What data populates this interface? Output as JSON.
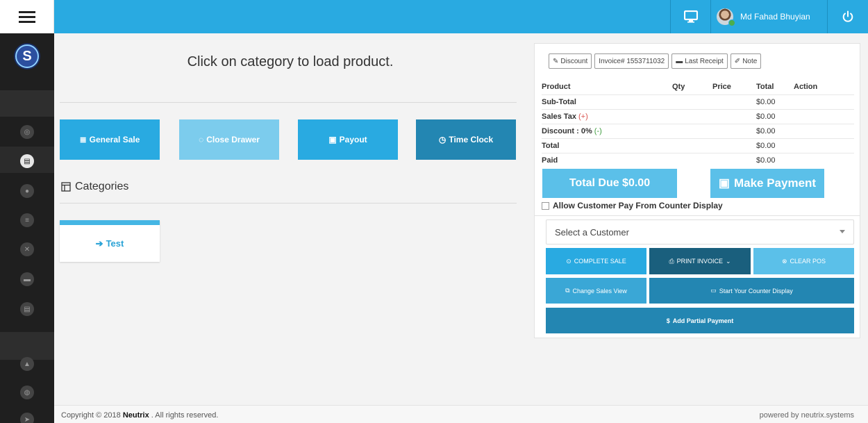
{
  "colors": {
    "topbar": "#29aae1",
    "sidebar": "#1f1f1f",
    "general_sale": "#29aae1",
    "close_drawer": "#7ccced",
    "payout": "#29aae1",
    "time_clock": "#2386b2",
    "total_due": "#5bc0e9",
    "complete_sale": "#29aae1",
    "print_invoice": "#1a5f7d",
    "clear_pos": "#5bc0e9",
    "change_sales_view": "#3aa7d6",
    "counter_display": "#2386b2",
    "partial_payment": "#2386b2"
  },
  "topbar": {
    "user_name": "Md Fahad Bhuyian",
    "monitor_icon": "monitor-icon",
    "power_icon": "power-icon"
  },
  "sidebar": {
    "logo_letter": "S",
    "icons": [
      "dashboard-icon",
      "basket-icon",
      "user-icon",
      "database-icon",
      "close-circle-icon",
      "cart-icon",
      "basket-icon",
      "chart-icon",
      "globe-icon",
      "arrow-icon"
    ]
  },
  "main": {
    "title": "Click on category to load product.",
    "buttons": {
      "general_sale": "General Sale",
      "close_drawer": "Close Drawer",
      "payout": "Payout",
      "time_clock": "Time Clock"
    },
    "categories_title": "Categories",
    "category_items": [
      {
        "label": "Test"
      }
    ]
  },
  "panel": {
    "toolbar": {
      "discount": "Discount",
      "invoice": "Invoice# 1553711032",
      "last_receipt": "Last Receipt",
      "note": "Note"
    },
    "columns": {
      "product": "Product",
      "qty": "Qty",
      "price": "Price",
      "total": "Total",
      "action": "Action"
    },
    "rows": {
      "subtotal": {
        "label": "Sub-Total",
        "value": "$0.00"
      },
      "sales_tax": {
        "label": "Sales Tax",
        "modifier": "(+)",
        "value": "$0.00"
      },
      "discount": {
        "label": "Discount : 0%",
        "modifier": "(-)",
        "value": "$0.00"
      },
      "total": {
        "label": "Total",
        "value": "$0.00"
      },
      "paid": {
        "label": "Paid",
        "value": "$0.00"
      }
    },
    "total_due": "Total Due $0.00",
    "make_payment": "Make Payment",
    "allow_counter": "Allow Customer Pay From Counter Display",
    "customer_select": "Select a Customer",
    "complete_sale": "COMPLETE SALE",
    "print_invoice": "PRINT INVOICE",
    "clear_pos": "CLEAR POS",
    "change_sales_view": "Change Sales View",
    "start_counter": "Start Your Counter Display",
    "add_partial": "Add Partial Payment"
  },
  "footer": {
    "copyright_prefix": "Copyright © 2018",
    "brand": "Neutrix",
    "copyright_suffix": ". All rights reserved.",
    "powered_by": "powered by neutrix.systems"
  }
}
